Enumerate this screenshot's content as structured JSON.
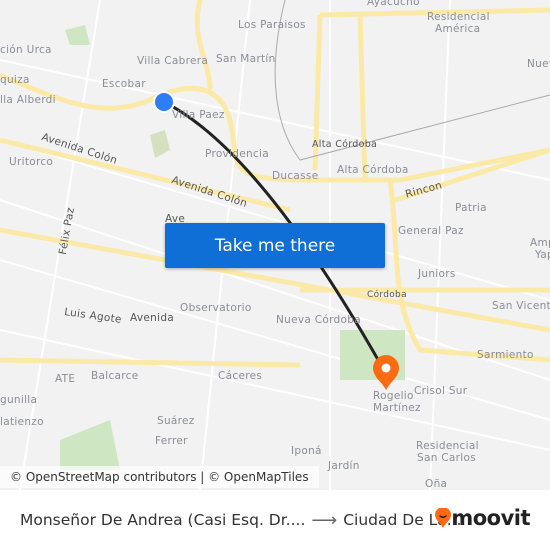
{
  "map": {
    "labels": [
      "ción Urca",
      "quiza",
      "lla Alberdi",
      "Escobar",
      "Villa Cabrera",
      "Los Paraisos",
      "San Martín",
      "Ayacucho",
      "Residencial",
      "América",
      "Nuev",
      "Villa Paez",
      "Avenida Colón",
      "Uritorco",
      "Providencia",
      "Ducasse",
      "Alta Córdoba",
      "Alta Córdoba",
      "Rincon",
      "Patria",
      "Avenida Colón",
      "Félix Paz",
      "General Paz",
      "Juniors",
      "Ampl",
      "Yap",
      "Córdoba",
      "San Vicente",
      "Luis Agote",
      "Avenida",
      "Observatorio",
      "Nueva Córdoba",
      "Sarmiento",
      "ATE",
      "Balcarce",
      "Cáceres",
      "Crisol Sur",
      "Rogelio",
      "Martínez",
      "gunilla",
      "latienzo",
      "Suárez",
      "Ferrer",
      "Iponá",
      "Residencial",
      "San Carlos",
      "Jardín",
      "Oña",
      "Ave"
    ],
    "origin_color": "#2e7cf6",
    "destination_color": "#ff6a13",
    "route_color": "#222222",
    "origin_icon": "origin-dot-icon",
    "destination_icon": "map-pin-icon"
  },
  "cta": {
    "label": "Take me there"
  },
  "attribution": "© OpenStreetMap contributors | © OpenMapTiles",
  "footer": {
    "from": "Monseñor De Andrea (Casi Esq. Dr....",
    "to": "Ciudad De La...",
    "arrow_icon": "arrow-right-icon"
  },
  "brand": {
    "name": "moovit",
    "color": "#ff6a13"
  }
}
